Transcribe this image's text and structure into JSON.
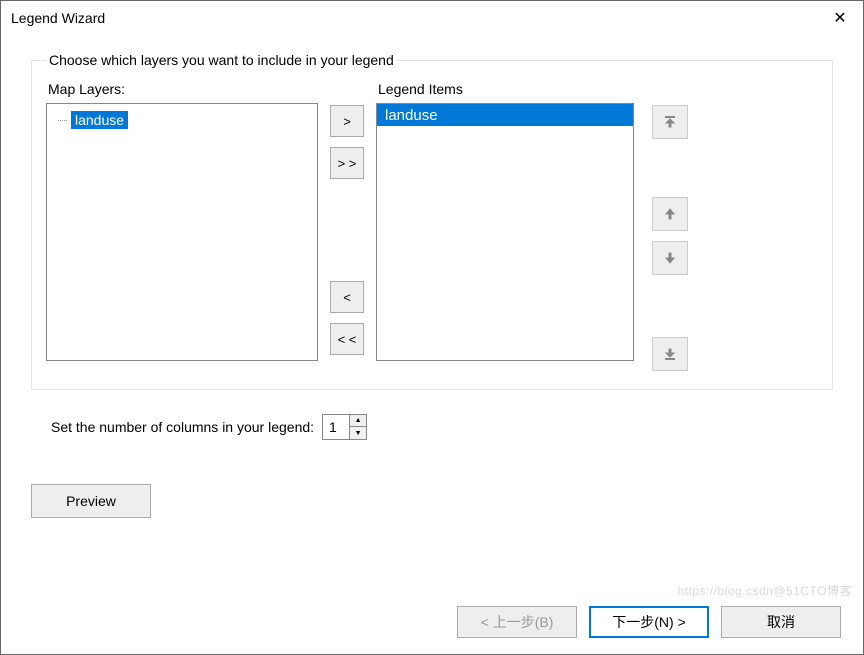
{
  "window": {
    "title": "Legend Wizard"
  },
  "header_text": "Choose which layers you want to include in your legend",
  "labels": {
    "map_layers": "Map Layers:",
    "legend_items": "Legend Items",
    "columns": "Set the number of columns in your legend:"
  },
  "map_layers": {
    "items": [
      {
        "name": "landuse",
        "selected": true
      }
    ]
  },
  "legend_items": {
    "items": [
      {
        "name": "landuse",
        "selected": true
      }
    ]
  },
  "buttons": {
    "add_one": ">",
    "add_all": "> >",
    "remove_one": "<",
    "remove_all": "< <",
    "preview": "Preview",
    "back": "< 上一步(B)",
    "next": "下一步(N) >",
    "cancel": "取消"
  },
  "columns_value": "1",
  "watermark": "https://blog.csdn@51CTO博客"
}
